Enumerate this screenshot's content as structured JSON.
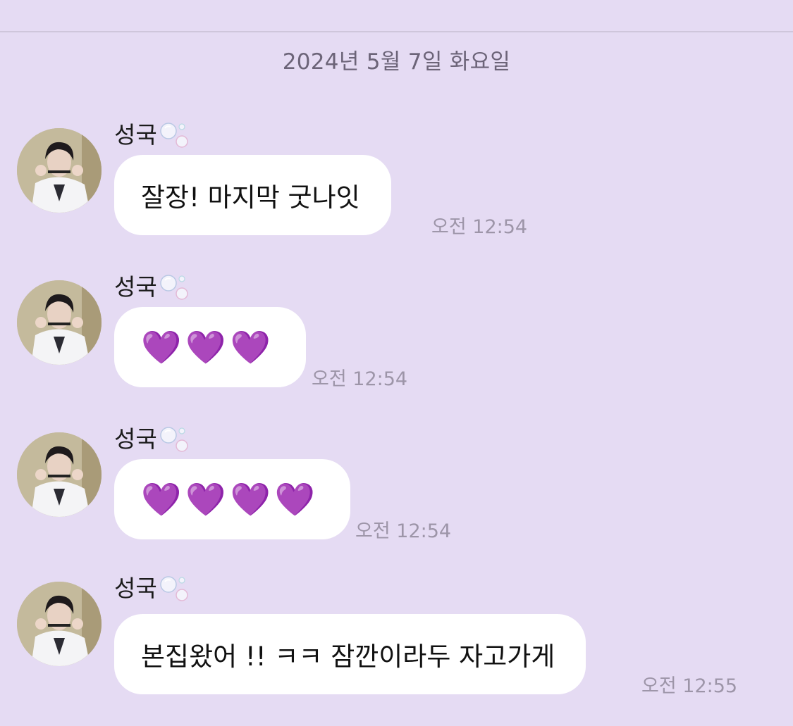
{
  "chat": {
    "date": "2024년 5월 7일 화요일",
    "messages": [
      {
        "sender": "성국",
        "text": "잘장! 마지막 굿나잇",
        "time": "오전 12:54"
      },
      {
        "sender": "성국",
        "text": "💜💜💜",
        "time": "오전 12:54"
      },
      {
        "sender": "성국",
        "text": "💜💜💜💜",
        "time": "오전 12:54"
      },
      {
        "sender": "성국",
        "text": "본집왔어 !! ㅋㅋ 잠깐이라두 자고가게",
        "time": "오전 12:55"
      }
    ]
  },
  "icons": {
    "avatar": "profile-photo",
    "sender_decoration": "soap-bubbles-icon"
  },
  "colors": {
    "background": "#e5dbf3",
    "bubble": "#ffffff",
    "heart": "#9b35e8",
    "timestamp": "#9d95a8"
  }
}
